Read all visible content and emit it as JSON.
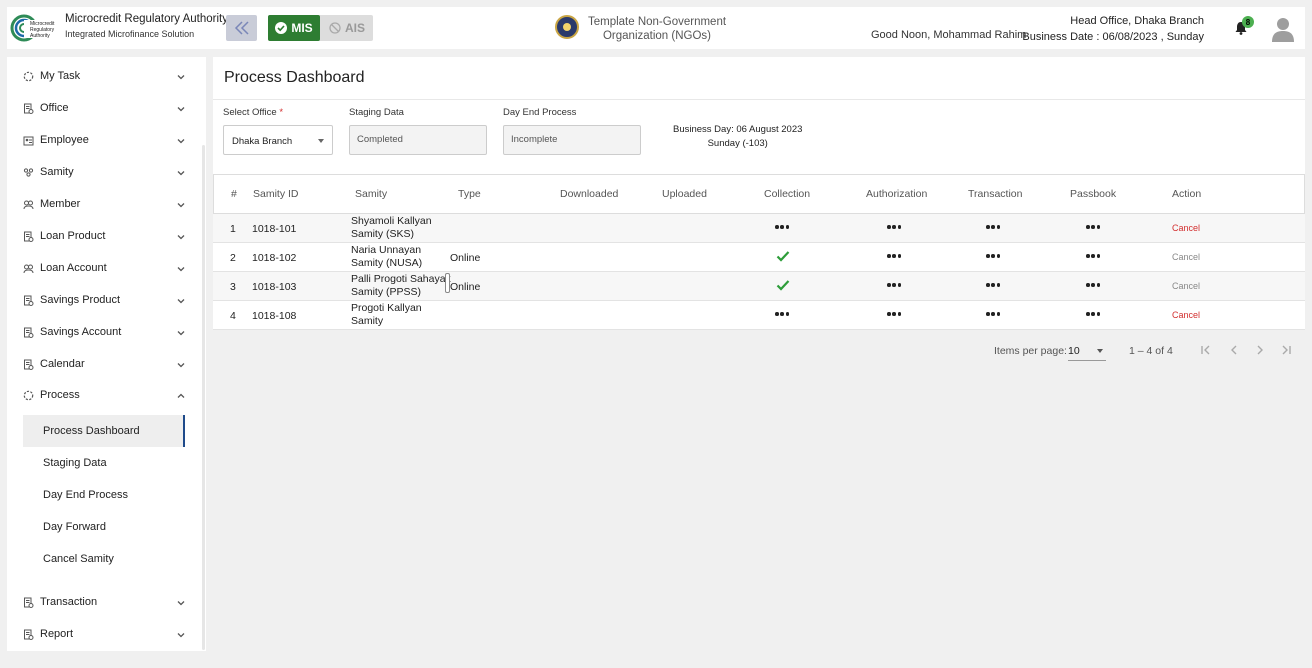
{
  "header": {
    "org_title": "Microcredit Regulatory Authority",
    "org_subtitle": "Integrated Microfinance Solution",
    "logo_text": [
      "Microcredit",
      "Regulatory",
      "Authority"
    ],
    "mis_label": "MIS",
    "ais_label": "AIS",
    "gov_text_line1": "Template Non-Government",
    "gov_text_line2": "Organization (NGOs)",
    "greeting": "Good Noon, Mohammad Rahim",
    "branch": "Head Office, Dhaka Branch",
    "business_date": "Business Date : 06/08/2023 , Sunday",
    "notification_count": "8"
  },
  "sidebar": {
    "items": [
      {
        "label": "My Task",
        "icon": "circle-dashed-icon"
      },
      {
        "label": "Office",
        "icon": "document-icon"
      },
      {
        "label": "Employee",
        "icon": "employee-icon"
      },
      {
        "label": "Samity",
        "icon": "group-icon"
      },
      {
        "label": "Member",
        "icon": "members-icon"
      },
      {
        "label": "Loan Product",
        "icon": "document-icon"
      },
      {
        "label": "Loan Account",
        "icon": "members-icon"
      },
      {
        "label": "Savings Product",
        "icon": "document-icon"
      },
      {
        "label": "Savings Account",
        "icon": "document-icon"
      },
      {
        "label": "Calendar",
        "icon": "document-icon"
      },
      {
        "label": "Process",
        "icon": "circle-dashed-icon"
      }
    ],
    "process_sub": [
      "Process Dashboard",
      "Staging Data",
      "Day End Process",
      "Day Forward",
      "Cancel Samity"
    ],
    "bottom_items": [
      {
        "label": "Transaction",
        "icon": "document-icon"
      },
      {
        "label": "Report",
        "icon": "document-icon"
      }
    ]
  },
  "main": {
    "title": "Process Dashboard",
    "select_office_label": "Select Office",
    "select_office_value": "Dhaka Branch",
    "staging_label": "Staging Data",
    "staging_value": "Completed",
    "day_end_label": "Day End Process",
    "day_end_value": "Incomplete",
    "business_day_line1": "Business Day: 06 August 2023",
    "business_day_line2": "Sunday (-103)"
  },
  "table": {
    "headers": [
      "#",
      "Samity ID",
      "Samity",
      "Type",
      "Downloaded",
      "Uploaded",
      "Collection",
      "Authorization",
      "Transaction",
      "Passbook",
      "Action"
    ],
    "rows": [
      {
        "num": "1",
        "id": "1018-101",
        "samity": "Shyamoli Kallyan Samity (SKS)",
        "type": "",
        "collection": "dots",
        "action": "Cancel",
        "action_color": "#d32f2f"
      },
      {
        "num": "2",
        "id": "1018-102",
        "samity": "Naria Unnayan Samity (NUSA)",
        "type": "Online",
        "collection": "check",
        "action": "Cancel",
        "action_color": "#888888"
      },
      {
        "num": "3",
        "id": "1018-103",
        "samity": "Palli Progoti Sahayak Samity (PPSS)",
        "type": "Online",
        "collection": "check",
        "action": "Cancel",
        "action_color": "#888888"
      },
      {
        "num": "4",
        "id": "1018-108",
        "samity": "Progoti Kallyan Samity",
        "type": "",
        "collection": "dots",
        "action": "Cancel",
        "action_color": "#d32f2f"
      }
    ]
  },
  "paginator": {
    "items_per_page_label": "Items per page:",
    "items_per_page": "10",
    "range": "1 – 4 of 4"
  },
  "colors": {
    "mis_green": "#2e7d32",
    "cancel_red": "#d32f2f",
    "check_green": "#2e9d3a",
    "active_border": "#1e4a8a"
  }
}
